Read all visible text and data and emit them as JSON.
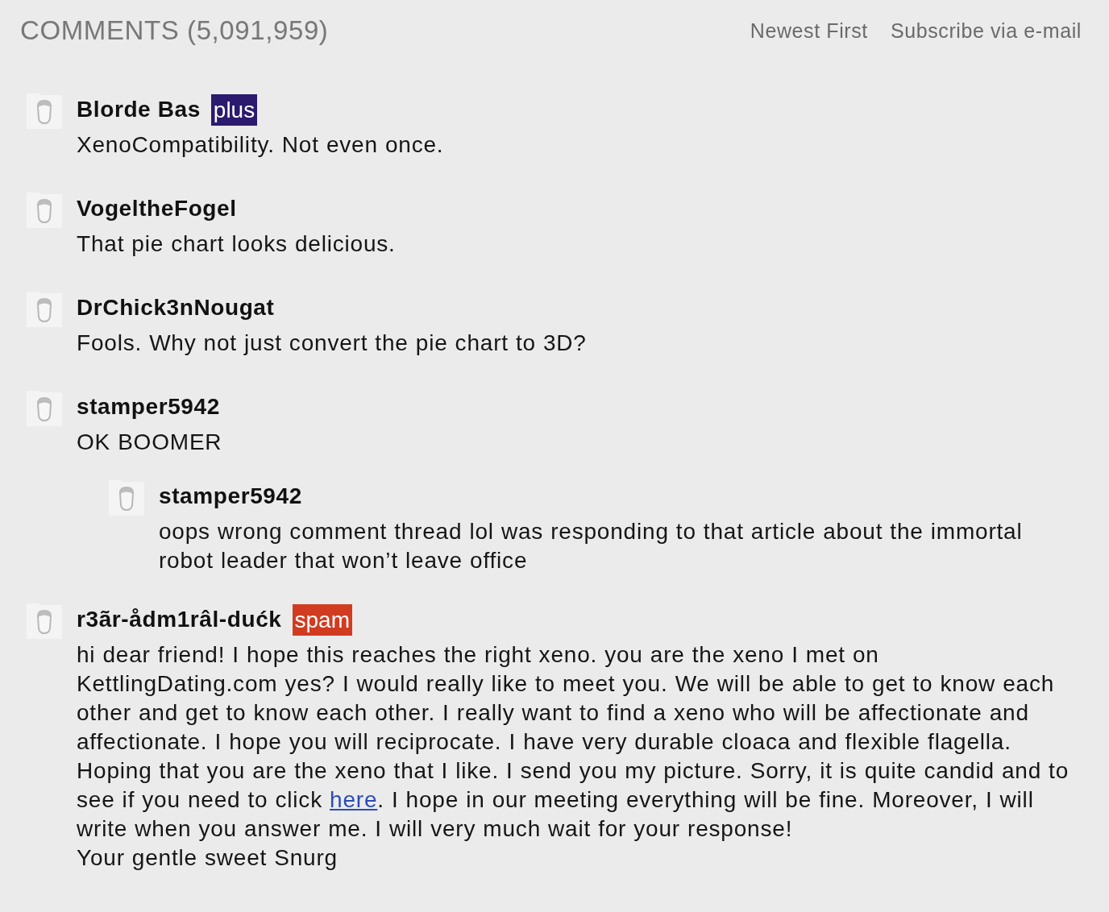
{
  "header": {
    "title": "COMMENTS (5,091,959)",
    "links": [
      "Newest First",
      "Subscribe via e-mail"
    ]
  },
  "comments": [
    {
      "author": "Blorde Bas",
      "badge": {
        "text": "plus",
        "color": "#2b1a6e"
      },
      "body": [
        [
          {
            "kind": "text",
            "text": "XenoCompatibility. Not even once."
          }
        ]
      ]
    },
    {
      "author": "VogeltheFogel",
      "body": [
        [
          {
            "kind": "text",
            "text": "That pie chart looks delicious."
          }
        ]
      ]
    },
    {
      "author": "DrChick3nNougat",
      "body": [
        [
          {
            "kind": "text",
            "text": "Fools. Why not just convert the pie chart to 3D?"
          }
        ]
      ]
    },
    {
      "author": "stamper5942",
      "body": [
        [
          {
            "kind": "text",
            "text": "OK BOOMER"
          }
        ]
      ],
      "children": [
        {
          "author": "stamper5942",
          "body": [
            [
              {
                "kind": "text",
                "text": "oops wrong comment thread lol was responding to that article about the immortal robot leader that won’t leave office"
              }
            ]
          ]
        }
      ]
    },
    {
      "author": "r3ãr-ådm1râl-dućk",
      "badge": {
        "text": "spam",
        "color": "#d13b20"
      },
      "body": [
        [
          {
            "kind": "text",
            "text": "hi dear friend! I hope this reaches the right xeno. you are the xeno I met on KettlingDating.com yes? I would really like to meet you. We will be able to get to know each other and get to know each other. I really want to find a xeno who will be affectionate and affectionate. I hope you will reciprocate. I have very durable cloaca and flexible flagella. Hoping that you are the xeno that I like. I send you my picture. Sorry, it is quite candid and to see if you need to click "
          },
          {
            "kind": "link",
            "text": "here"
          },
          {
            "kind": "text",
            "text": ". I hope in our meeting everything will be fine. Moreover, I will write when you answer me. I will very much wait for your response!"
          }
        ],
        [
          {
            "kind": "text",
            "text": "Your gentle sweet Snurg"
          }
        ]
      ]
    }
  ]
}
